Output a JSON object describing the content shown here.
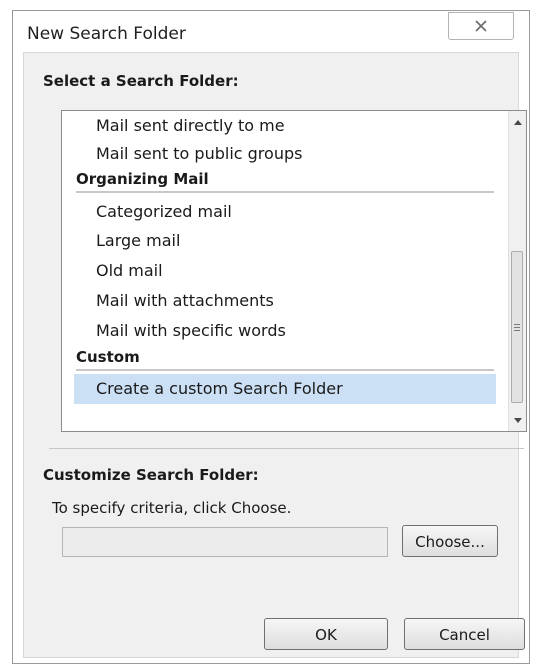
{
  "window": {
    "title": "New Search Folder",
    "close_icon": "close-x-icon"
  },
  "select_section": {
    "label": "Select a Search Folder:",
    "items": [
      {
        "type": "item",
        "label": "Mail sent directly to me",
        "selected": false
      },
      {
        "type": "item",
        "label": "Mail sent to public groups",
        "selected": false
      },
      {
        "type": "group",
        "label": "Organizing Mail"
      },
      {
        "type": "item",
        "label": "Categorized mail",
        "selected": false
      },
      {
        "type": "item",
        "label": "Large mail",
        "selected": false
      },
      {
        "type": "item",
        "label": "Old mail",
        "selected": false
      },
      {
        "type": "item",
        "label": "Mail with attachments",
        "selected": false
      },
      {
        "type": "item",
        "label": "Mail with specific words",
        "selected": false
      },
      {
        "type": "group",
        "label": "Custom"
      },
      {
        "type": "item",
        "label": "Create a custom Search Folder",
        "selected": true
      }
    ],
    "scrollbar": {
      "up_icon": "scroll-up-arrow-icon",
      "down_icon": "scroll-down-arrow-icon"
    }
  },
  "customize_section": {
    "label": "Customize Search Folder:",
    "hint": "To specify criteria, click Choose.",
    "criteria_value": "",
    "choose_label": "Choose..."
  },
  "footer": {
    "ok_label": "OK",
    "cancel_label": "Cancel"
  },
  "colors": {
    "selection": "#cce0f5",
    "body_background": "#f0f0f0"
  }
}
